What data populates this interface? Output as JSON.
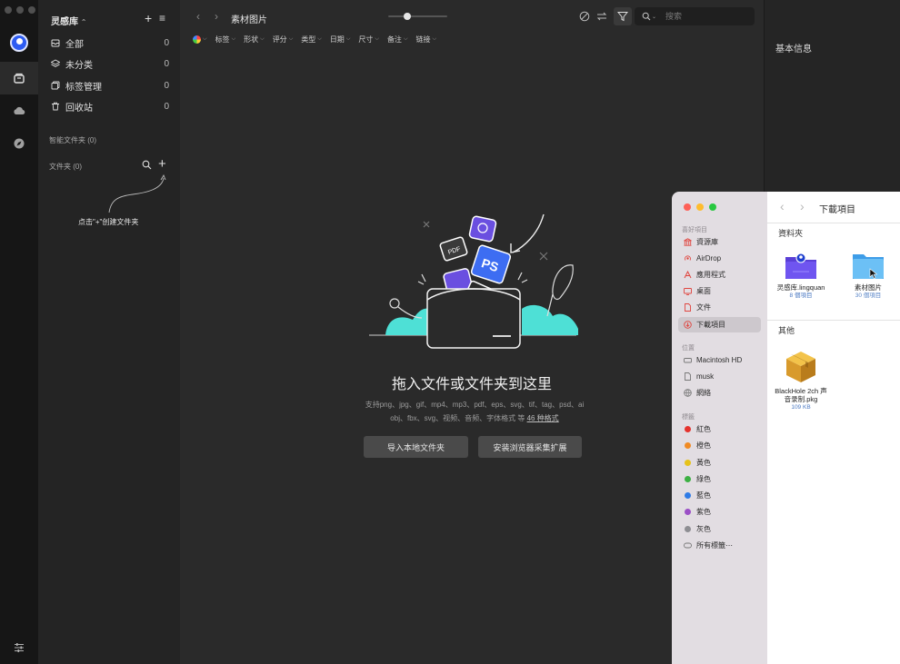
{
  "sidebar": {
    "library_name": "灵感库",
    "items": [
      {
        "label": "全部",
        "count": "0"
      },
      {
        "label": "未分类",
        "count": "0"
      },
      {
        "label": "标签管理",
        "count": "0"
      },
      {
        "label": "回收站",
        "count": "0"
      }
    ],
    "smart_folders_label": "智能文件夹 (0)",
    "folders_label": "文件夹 (0)",
    "create_folder_hint": "点击\"+\"创建文件夹"
  },
  "toolbar": {
    "title": "素材图片",
    "zoom_level": 0.33,
    "search_placeholder": "搜索"
  },
  "filters": [
    "标签",
    "形状",
    "评分",
    "类型",
    "日期",
    "尺寸",
    "备注",
    "链接"
  ],
  "dropzone": {
    "title": "拖入文件或文件夹到这里",
    "description": "支持png、jpg、gif、mp4、mp3、pdf、eps、svg、tif、tag、psd、ai obj、fbx、svg、视频、音频、字体格式 等",
    "formats_link": "46 种格式",
    "import_button": "导入本地文件夹",
    "extension_button": "安装浏览器采集扩展"
  },
  "info_panel": {
    "title": "基本信息"
  },
  "finder": {
    "title": "下載項目",
    "favorites_label": "喜好項目",
    "favorites": [
      {
        "label": "資源庫",
        "icon": "building-icon"
      },
      {
        "label": "AirDrop",
        "icon": "airdrop-icon"
      },
      {
        "label": "應用程式",
        "icon": "apps-icon"
      },
      {
        "label": "桌面",
        "icon": "desktop-icon"
      },
      {
        "label": "文件",
        "icon": "document-icon"
      },
      {
        "label": "下載項目",
        "icon": "download-icon",
        "selected": true
      }
    ],
    "locations_label": "位置",
    "locations": [
      {
        "label": "Macintosh HD",
        "icon": "disk-icon"
      },
      {
        "label": "musk",
        "icon": "file-icon"
      },
      {
        "label": "網絡",
        "icon": "network-icon"
      }
    ],
    "tags_label": "標籤",
    "tags": [
      {
        "label": "紅色",
        "color": "#e5322d"
      },
      {
        "label": "橙色",
        "color": "#f08a24"
      },
      {
        "label": "黃色",
        "color": "#e6c21a"
      },
      {
        "label": "綠色",
        "color": "#3cb043"
      },
      {
        "label": "藍色",
        "color": "#2f7be6"
      },
      {
        "label": "紫色",
        "color": "#9b4fc6"
      },
      {
        "label": "灰色",
        "color": "#8e8e93"
      }
    ],
    "all_tags_label": "所有標籤⋯",
    "folders_group": "資料夾",
    "folders": [
      {
        "name": "灵感库.lingquan",
        "meta": "8 個項目"
      },
      {
        "name": "素材图片",
        "meta": "30 個項目"
      }
    ],
    "other_group": "其他",
    "files": [
      {
        "name_line1": "BlackHole 2ch 声",
        "name_line2": "音录制.pkg",
        "meta": "109 KB"
      }
    ]
  },
  "colors": {
    "accent_blue": "#2d5cf2",
    "illustration_teal": "#4ee0d6",
    "illustration_purple": "#6a4fe0"
  }
}
